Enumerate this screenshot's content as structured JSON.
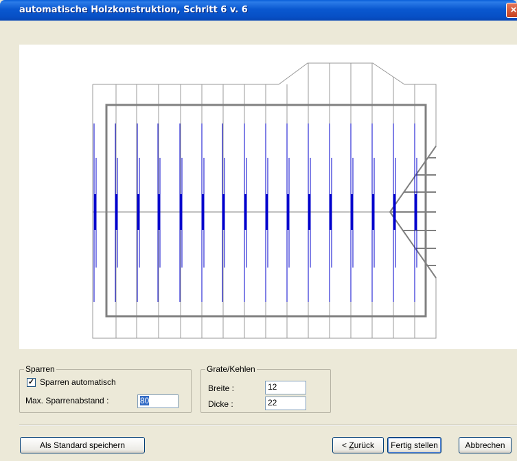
{
  "window": {
    "title": "automatische Holzkonstruktion, Schritt 6 v. 6",
    "close_icon": "×"
  },
  "sparren": {
    "legend": "Sparren",
    "auto_label": "Sparren automatisch",
    "auto_checked": true,
    "abstand_label": "Max. Sparrenabstand :",
    "abstand_value": "80"
  },
  "grate": {
    "legend": "Grate/Kehlen",
    "breite_label": "Breite :",
    "breite_value": "12",
    "dicke_label": "Dicke :",
    "dicke_value": "22"
  },
  "buttons": {
    "save_default": "Als Standard speichern",
    "back_prefix": "< ",
    "back_mnemonic": "Z",
    "back_rest": "urück",
    "finish": "Fertig stellen",
    "cancel": "Abbrechen"
  },
  "colors": {
    "rafter_blue": "#0000cc",
    "outline_gray": "#808080",
    "line_gray": "#999999"
  }
}
